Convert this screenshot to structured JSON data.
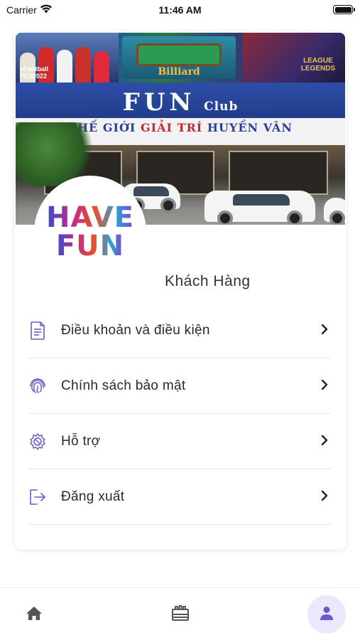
{
  "status_bar": {
    "carrier": "Carrier",
    "time": "11:46 AM"
  },
  "banner": {
    "sign_main": "FUN",
    "sign_club": "Club",
    "sign_sub_left": "THẾ GIỚI ",
    "sign_sub_red": "GIẢI TRÍ",
    "sign_sub_right": " HUYỀN VÂN",
    "poster_billiard": "Billiard",
    "poster_football_line1": "eFootball",
    "poster_football_line2": "PES2022",
    "poster_lol_line1": "LEAGUE",
    "poster_lol_line2": "LEGENDS"
  },
  "logo": {
    "line1": "HAVE",
    "line2": "FUN"
  },
  "profile": {
    "name": "Khách Hàng"
  },
  "menu": {
    "items": [
      {
        "label": "Điều khoản và điều kiện",
        "icon": "document-icon"
      },
      {
        "label": "Chính sách bảo mật",
        "icon": "fingerprint-icon"
      },
      {
        "label": "Hỗ trợ",
        "icon": "support-gear-icon"
      },
      {
        "label": "Đăng xuất",
        "icon": "logout-icon"
      }
    ]
  },
  "bottom_nav": {
    "items": [
      {
        "name": "home",
        "icon": "home-icon",
        "active": false
      },
      {
        "name": "store",
        "icon": "store-icon",
        "active": false
      },
      {
        "name": "profile",
        "icon": "person-icon",
        "active": true
      }
    ]
  },
  "colors": {
    "accent": "#6a5acd",
    "active_nav_bg": "#ece8fb",
    "divider": "#e6e6e6"
  }
}
